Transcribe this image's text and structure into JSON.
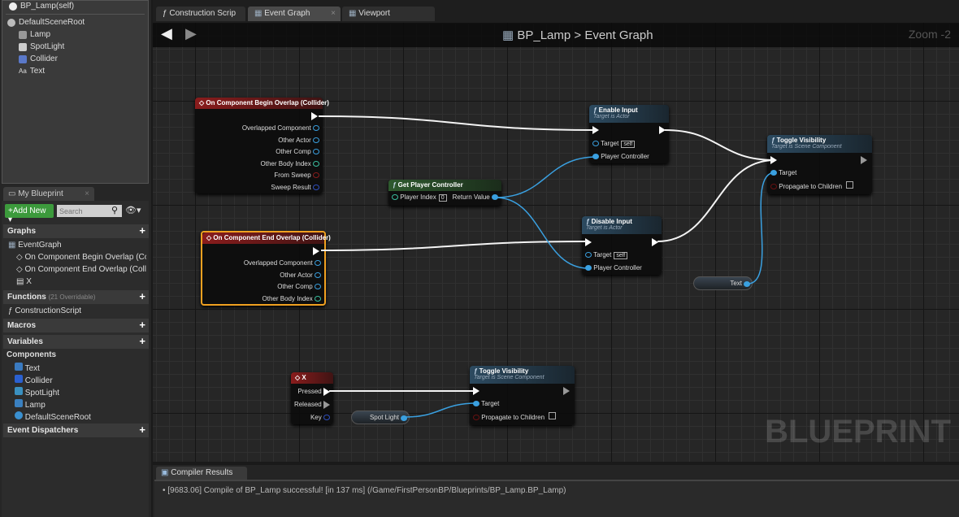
{
  "components": {
    "self": "BP_Lamp(self)",
    "root": "DefaultSceneRoot",
    "children": [
      "Lamp",
      "SpotLight",
      "Collider",
      "Text"
    ]
  },
  "my_blueprint": {
    "tab": "My Blueprint",
    "add_new": "Add New",
    "search_placeholder": "Search",
    "graphs": {
      "label": "Graphs",
      "event_graph": "EventGraph",
      "items": [
        "On Component Begin Overlap (Collider)",
        "On Component End Overlap (Collider)",
        "X"
      ]
    },
    "functions": {
      "label": "Functions",
      "count": "(21 Overridable)",
      "items": [
        "ConstructionScript"
      ]
    },
    "macros": "Macros",
    "variables": "Variables",
    "components": {
      "label": "Components",
      "items": [
        "Text",
        "Collider",
        "SpotLight",
        "Lamp",
        "DefaultSceneRoot"
      ]
    },
    "event_dispatchers": "Event Dispatchers"
  },
  "tabs": [
    {
      "label": "Construction Scrip",
      "icon": "function-icon"
    },
    {
      "label": "Event Graph",
      "icon": "graph-icon",
      "active": true
    },
    {
      "label": "Viewport",
      "icon": "viewport-icon"
    }
  ],
  "graph": {
    "breadcrumb_blueprint": "BP_Lamp",
    "breadcrumb_separator": ">",
    "breadcrumb_graph": "Event Graph",
    "zoom": "Zoom -2",
    "watermark": "BLUEPRINT",
    "nodes": {
      "begin_overlap": {
        "title": "On Component Begin Overlap (Collider)",
        "outputs": [
          "Overlapped Component",
          "Other Actor",
          "Other Comp",
          "Other Body Index",
          "From Sweep",
          "Sweep Result"
        ]
      },
      "end_overlap": {
        "title": "On Component End Overlap (Collider)",
        "outputs": [
          "Overlapped Component",
          "Other Actor",
          "Other Comp",
          "Other Body Index"
        ]
      },
      "get_pc": {
        "title": "Get Player Controller",
        "input": "Player Index",
        "input_value": "0",
        "output": "Return Value"
      },
      "enable_input": {
        "title": "Enable Input",
        "subtitle": "Target is Actor",
        "target": "Target",
        "target_value": "self",
        "pc": "Player Controller"
      },
      "disable_input": {
        "title": "Disable Input",
        "subtitle": "Target is Actor",
        "target": "Target",
        "target_value": "self",
        "pc": "Player Controller"
      },
      "toggle1": {
        "title": "Toggle Visibility",
        "subtitle": "Target is Scene Component",
        "target": "Target",
        "propagate": "Propagate to Children"
      },
      "toggle2": {
        "title": "Toggle Visibility",
        "subtitle": "Target is Scene Component",
        "target": "Target",
        "propagate": "Propagate to Children"
      },
      "text_var": "Text",
      "spot_var": "Spot Light",
      "key_x": {
        "title": "X",
        "pressed": "Pressed",
        "released": "Released",
        "key": "Key"
      }
    }
  },
  "compiler": {
    "tab": "Compiler Results",
    "message": "[9683.06] Compile of BP_Lamp successful! [in 137 ms] (/Game/FirstPersonBP/Blueprints/BP_Lamp.BP_Lamp)"
  },
  "colors": {
    "event_header": "#8a1c1c",
    "function_header": "#2c4a60",
    "pure_header": "#2e5a2e",
    "object_pin": "#3aa0e0",
    "selected": "#f0a020"
  }
}
